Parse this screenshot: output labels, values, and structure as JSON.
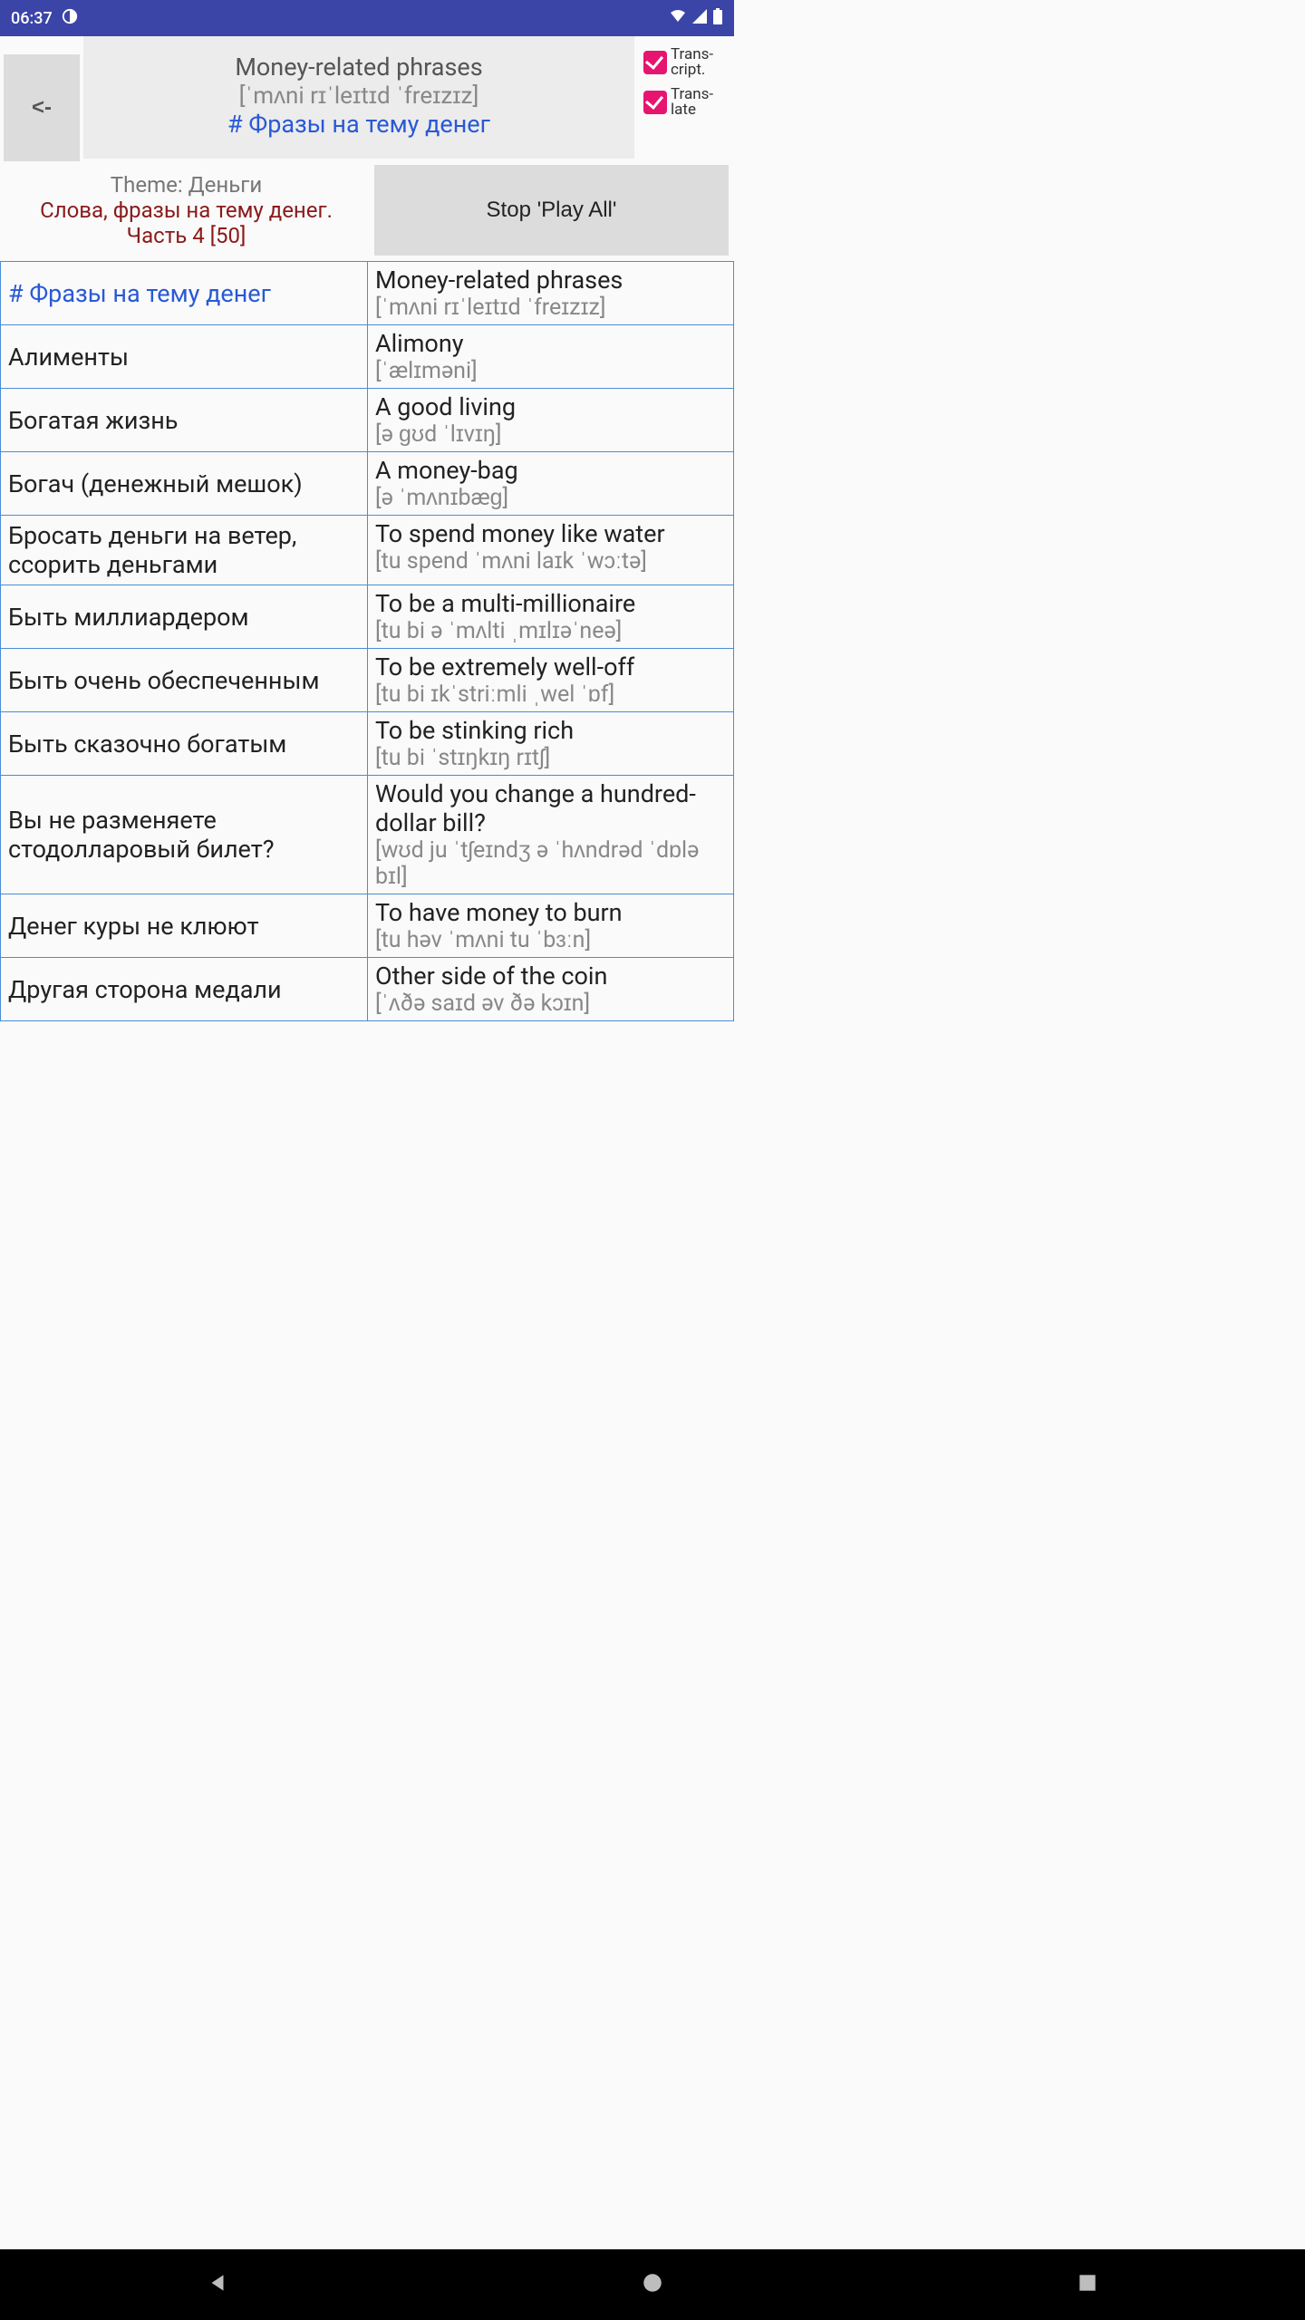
{
  "status": {
    "time": "06:37"
  },
  "header": {
    "back_label": "<-",
    "title_en": "Money-related phrases",
    "title_ipa": "[ˈmʌni rɪˈleɪtɪd ˈfreɪzɪz]",
    "title_ru": "# Фразы на тему денег"
  },
  "checkboxes": {
    "transcript_label": "Trans-cript.",
    "translate_label": "Trans-late"
  },
  "theme": {
    "label": "Theme: Деньги",
    "desc": "Слова, фразы на тему денег. Часть 4 [50]",
    "stop_label": "Stop 'Play All'"
  },
  "rows": [
    {
      "ru": "# Фразы на тему денег",
      "ru_link": true,
      "en": "Money-related phrases",
      "ipa": "[ˈmʌni rɪˈleɪtɪd ˈfreɪzɪz]"
    },
    {
      "ru": "Алименты",
      "en": "Alimony",
      "ipa": "[ˈælɪməni]"
    },
    {
      "ru": "Богатая жизнь",
      "en": "A good living",
      "ipa": "[ə ɡʊd ˈlɪvɪŋ]"
    },
    {
      "ru": "Богач (денежный мешок)",
      "en": "A money-bag",
      "ipa": "[ə ˈmʌnɪbæɡ]"
    },
    {
      "ru": "Бросать деньги на ветер, ссорить деньгами",
      "en": "To spend money like water",
      "ipa": "[tu spend ˈmʌni laɪk ˈwɔːtə]"
    },
    {
      "ru": "Быть миллиардером",
      "en": "To be a multi-millionaire",
      "ipa": "[tu bi ə ˈmʌlti ˌmɪlɪəˈneə]"
    },
    {
      "ru": "Быть очень обеспеченным",
      "en": "To be extremely well-off",
      "ipa": "[tu bi ɪkˈstriːmli ˌwel ˈɒf]"
    },
    {
      "ru": "Быть сказочно богатым",
      "en": "To be stinking rich",
      "ipa": "[tu bi ˈstɪŋkɪŋ rɪtʃ]"
    },
    {
      "ru": "Вы не разменяете стодолларовый билет?",
      "en": "Would you change a hundred-dollar bill?",
      "ipa": "[wʊd ju ˈtʃeɪndʒ ə ˈhʌndrəd ˈdɒlə bɪl]"
    },
    {
      "ru": "Денег куры не клюют",
      "en": "To have money to burn",
      "ipa": "[tu həv ˈmʌni tu ˈbɜːn]"
    },
    {
      "ru": "Другая сторона медали",
      "en": "Other side of the coin",
      "ipa": "[ˈʌðə saɪd əv ðə kɔɪn]"
    }
  ]
}
